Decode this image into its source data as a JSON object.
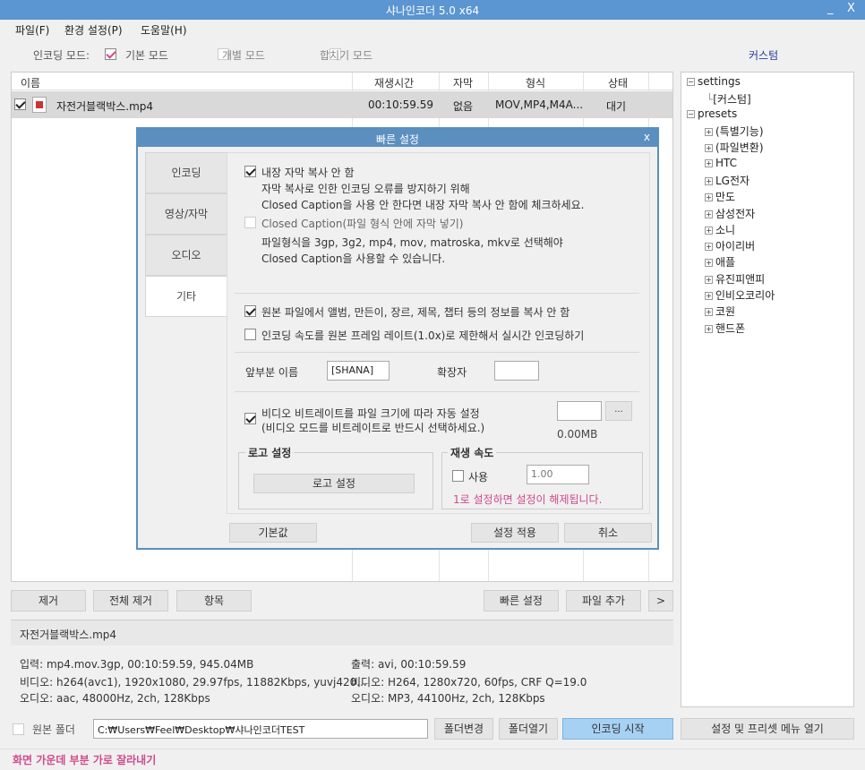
{
  "app": {
    "title": "샤나인코더  5.0 x64",
    "min": "_",
    "close": "X"
  },
  "menu": [
    "파일(F)",
    "환경 설정(P)",
    "도움말(H)"
  ],
  "mode": {
    "label": "인코딩 모드:",
    "basic": "기본 모드",
    "individual": "개별 모드",
    "merge": "합치기 모드",
    "custom": "커스텀"
  },
  "table": {
    "headers": [
      "이름",
      "재생시간",
      "자막",
      "형식",
      "상태"
    ],
    "row": {
      "name": "자전거블랙박스.mp4",
      "duration": "00:10:59.59",
      "subtitle": "없음",
      "format": "MOV,MP4,M4A...",
      "status": "대기"
    }
  },
  "tree": {
    "settings": "settings",
    "custom": "[커스텀]",
    "presets": "presets",
    "items": [
      "(특별기능)",
      "(파일변환)",
      "HTC",
      "LG전자",
      "만도",
      "삼성전자",
      "소니",
      "아이리버",
      "애플",
      "유진피앤피",
      "인비오코리아",
      "코원",
      "핸드폰"
    ]
  },
  "dialog": {
    "title": "빠른 설정",
    "close": "x",
    "tabs": [
      "인코딩",
      "영상/자막",
      "오디오",
      "기타"
    ],
    "opt1": "내장 자막 복사 안 함",
    "opt1_d1": "자막 복사로 인한 인코딩 오류를 방지하기 위해",
    "opt1_d2": "Closed Caption을 사용 안 한다면 내장 자막 복사 안 함에 체크하세요.",
    "opt2": "Closed Caption(파일 형식 안에 자막 넣기)",
    "opt2_d1": "파일형식을 3gp, 3g2, mp4, mov, matroska, mkv로 선택해야",
    "opt2_d2": "Closed Caption을 사용할 수 있습니다.",
    "opt3": "원본 파일에서 앨범, 만든이, 장르, 제목, 챕터 등의 정보를 복사 안 함",
    "opt4": "인코딩 속도를 원본 프레임 레이트(1.0x)로 제한해서 실시간 인코딩하기",
    "prefix_label": "앞부분 이름",
    "prefix_value": "[SHANA]",
    "ext_label": "확장자",
    "opt5": "비디오 비트레이트를 파일 크기에 따라 자동 설정",
    "opt5_d": "(비디오 모드를 비트레이트로 반드시 선택하세요.)",
    "size": "0.00MB",
    "browse": "...",
    "logo_group": "로고 설정",
    "logo_btn": "로고 설정",
    "speed_group": "재생 속도",
    "speed_use": "사용",
    "speed_value": "1.00",
    "speed_note": "1로 설정하면 설정이 해제됩니다.",
    "default_btn": "기본값",
    "apply_btn": "설정 적용",
    "cancel_btn": "취소"
  },
  "actions": {
    "remove": "제거",
    "remove_all": "전체 제거",
    "items": "항목",
    "quick": "빠른 설정",
    "add": "파일 추가",
    "more": ">"
  },
  "info": {
    "file": "자전거블랙박스.mp4",
    "in1": "입력: mp4.mov.3gp, 00:10:59.59, 945.04MB",
    "in2": "비디오: h264(avc1), 1920x1080, 29.97fps, 11882Kbps,  yuvj420...",
    "in3": "오디오: aac, 48000Hz, 2ch, 128Kbps",
    "out1": "출력: avi, 00:10:59.59",
    "out2": "비디오: H264, 1280x720, 60fps, CRF Q=19.0",
    "out3": "오디오: MP3, 44100Hz, 2ch, 128Kbps"
  },
  "bottom": {
    "src_folder": "원본 폴더",
    "path": "C:₩Users₩Feel₩Desktop₩샤나인코더TEST",
    "change": "폴더변경",
    "open": "폴더열기",
    "start": "인코딩 시작",
    "settings_menu": "설정 및 프리셋 메뉴 열기"
  },
  "status": "화면 가운데 부분 가로 잘라내기",
  "colors": {
    "title": "#5b95d2",
    "accent": "#d04a8a",
    "start_btn": "#a6d1f3"
  }
}
